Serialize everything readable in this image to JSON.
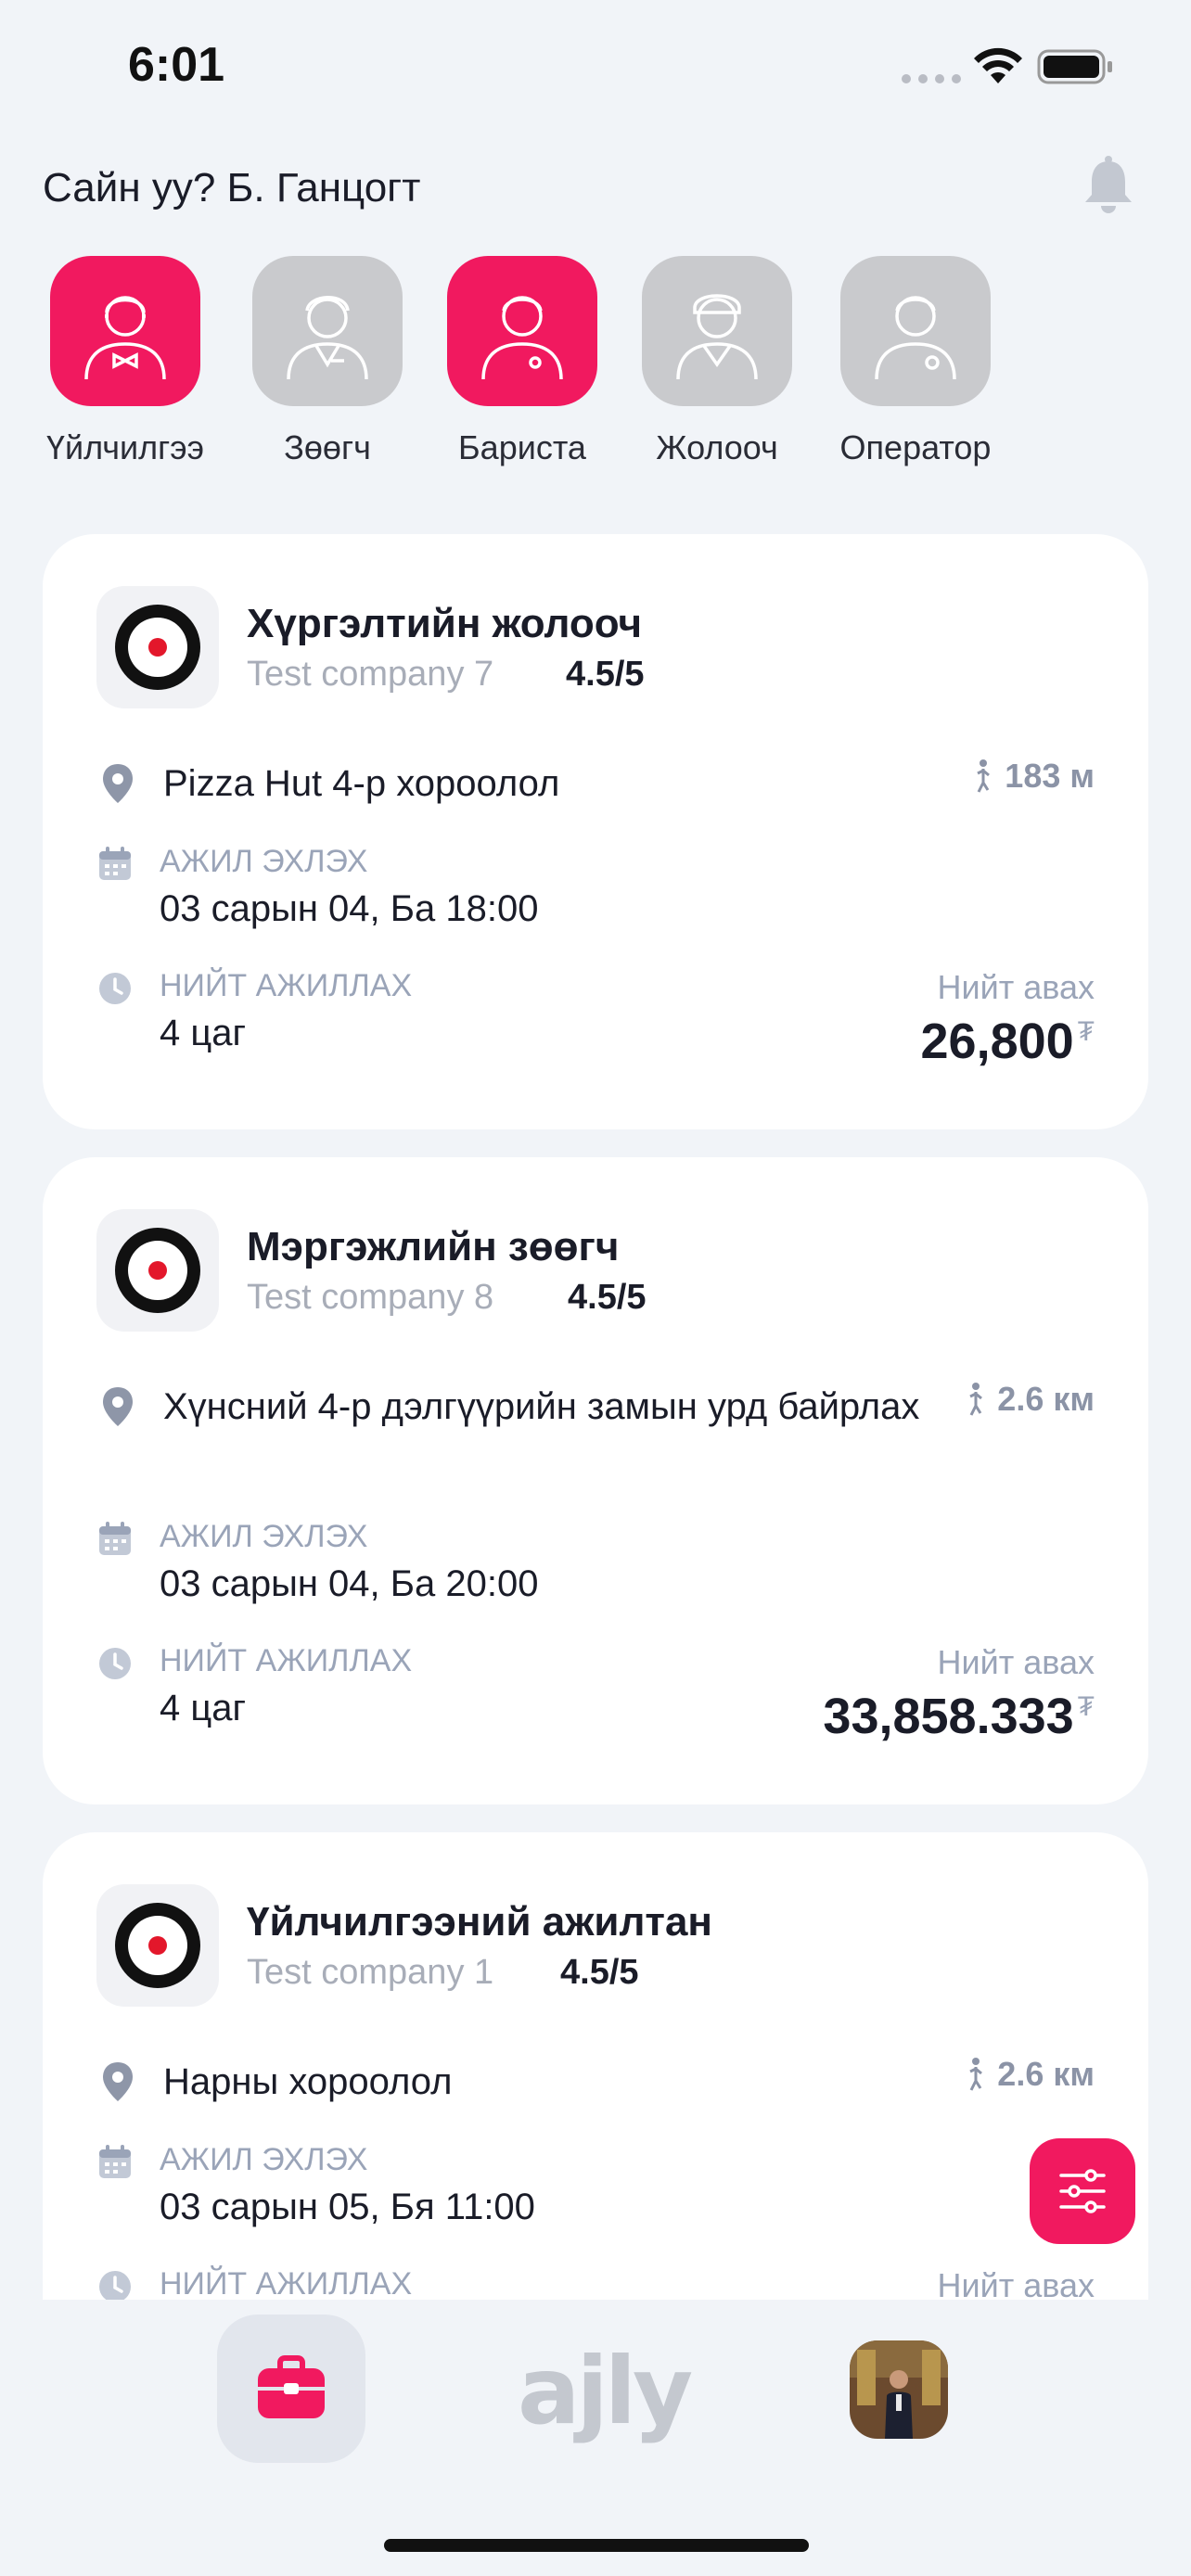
{
  "status_bar": {
    "time": "6:01"
  },
  "header": {
    "greeting": "Сайн уу? Б. Ганцогт",
    "bell_icon": "bell-icon"
  },
  "categories": [
    {
      "label": "Үйлчилгээ",
      "active": true,
      "icon": "waiter-avatar-icon"
    },
    {
      "label": "Зөөгч",
      "active": false,
      "icon": "server-avatar-icon"
    },
    {
      "label": "Бариста",
      "active": true,
      "icon": "barista-avatar-icon"
    },
    {
      "label": "Жолооч",
      "active": false,
      "icon": "driver-avatar-icon"
    },
    {
      "label": "Оператор",
      "active": false,
      "icon": "operator-avatar-icon"
    }
  ],
  "jobs": [
    {
      "title": "Хүргэлтийн жолооч",
      "company": "Test company 7",
      "rating": "4.5/5",
      "address": "Pizza Hut 4-р хороолол",
      "distance": "183 м",
      "start_label": "АЖИЛ ЭХЛЭХ",
      "start_value": "03 сарын 04, Ба 18:00",
      "duration_label": "НИЙТ АЖИЛЛАХ",
      "duration_value": "4 цаг",
      "total_label": "Нийт авах",
      "total_amount": "26,800",
      "currency": "₮"
    },
    {
      "title": "Мэргэжлийн зөөгч",
      "company": "Test company 8",
      "rating": "4.5/5",
      "address": "Хүнсний 4-р дэлгүүрийн замын урд байрлах",
      "distance": "2.6 км",
      "start_label": "АЖИЛ ЭХЛЭХ",
      "start_value": "03 сарын 04, Ба 20:00",
      "duration_label": "НИЙТ АЖИЛЛАХ",
      "duration_value": "4 цаг",
      "total_label": "Нийт авах",
      "total_amount": "33,858.333",
      "currency": "₮"
    },
    {
      "title": "Үйлчилгээний ажилтан",
      "company": "Test company 1",
      "rating": "4.5/5",
      "address": "Нарны хороолол",
      "distance": "2.6 км",
      "start_label": "АЖИЛ ЭХЛЭХ",
      "start_value": "03 сарын 05, Бя 11:00",
      "duration_label": "НИЙТ АЖИЛЛАХ",
      "total_label": "Нийт авах"
    }
  ],
  "bottom_nav": {
    "logo": "ajly",
    "jobs_icon": "briefcase-icon",
    "profile_icon": "profile-photo"
  },
  "colors": {
    "accent": "#f1195f",
    "inactive": "#c9cacd",
    "background": "#f1f4f8",
    "muted": "#9aa4b8"
  }
}
